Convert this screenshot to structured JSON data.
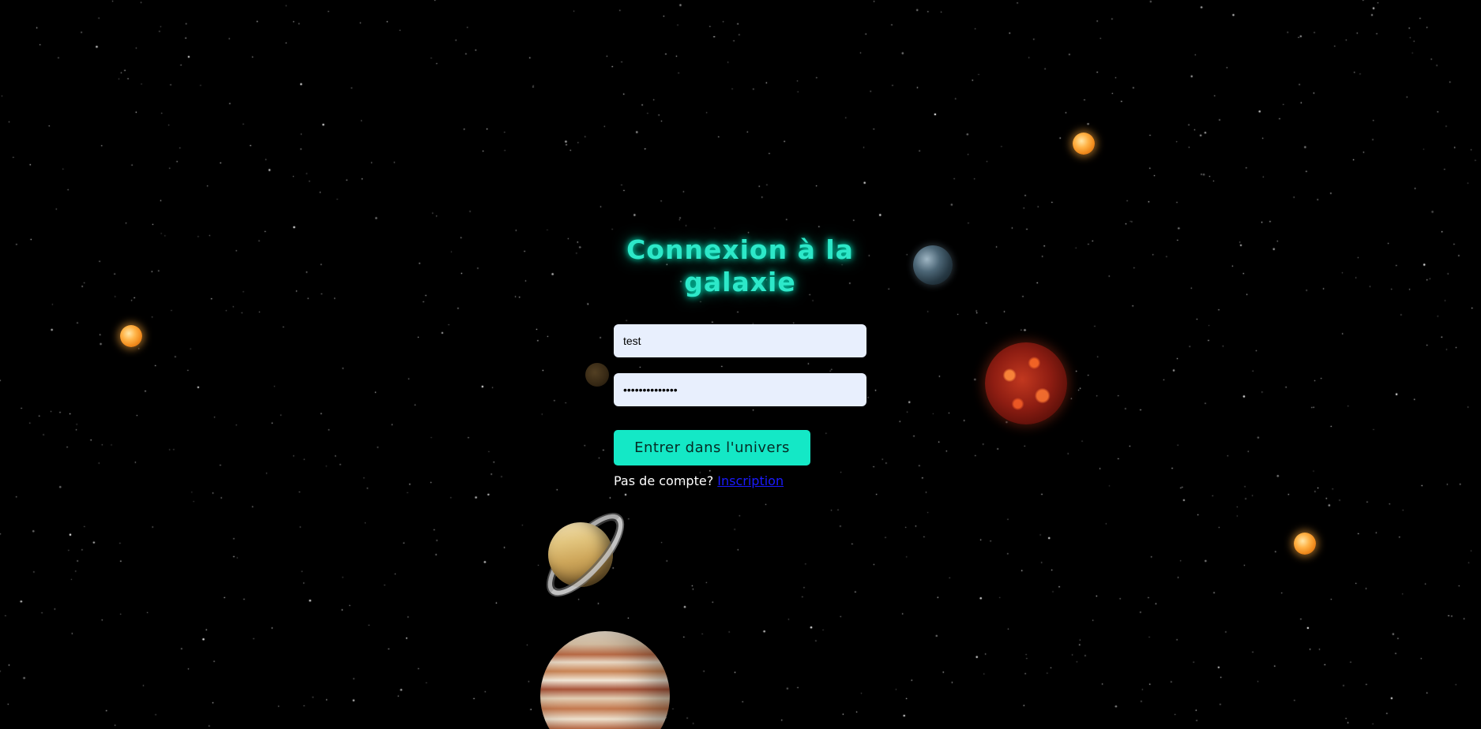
{
  "page": {
    "title": "Connexion à la galaxie"
  },
  "form": {
    "username_value": "test",
    "password_value": "••••••••••••••",
    "submit_label": "Entrer dans l'univers",
    "no_account_text": "Pas de compte?",
    "signup_link_label": "Inscription"
  },
  "colors": {
    "title_glow": "#2de8c9",
    "button_bg": "#14e8c6",
    "input_bg": "#e8effd",
    "link": "#1a1aff",
    "background": "#000000"
  },
  "decor": {
    "planets": [
      "sun-small",
      "earthlike-planet",
      "lava-planet",
      "saturn",
      "jupiter",
      "dim-moon"
    ]
  }
}
